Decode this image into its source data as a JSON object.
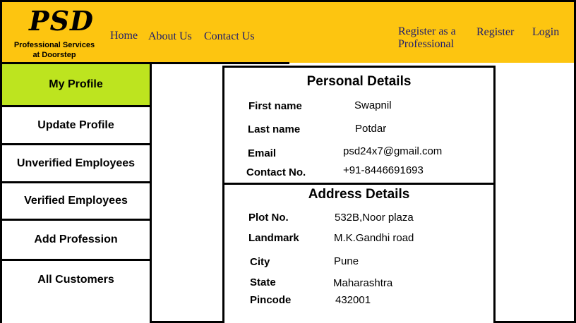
{
  "brand": {
    "logo": "PSD",
    "tagline_line1": "Professional Services",
    "tagline_line2": "at Doorstep"
  },
  "nav": {
    "home": "Home",
    "about": "About Us",
    "contact": "Contact Us",
    "register_professional_line1": "Register as a",
    "register_professional_line2": "Professional",
    "register": "Register",
    "login": "Login"
  },
  "sidebar": {
    "items": [
      {
        "label": "My Profile",
        "active": true
      },
      {
        "label": "Update Profile",
        "active": false
      },
      {
        "label": "Unverified Employees",
        "active": false
      },
      {
        "label": "Verified Employees",
        "active": false
      },
      {
        "label": "Add Profession",
        "active": false
      },
      {
        "label": "All Customers",
        "active": false
      }
    ]
  },
  "personal": {
    "title": "Personal Details",
    "first_name_label": "First name",
    "first_name": "Swapnil",
    "last_name_label": "Last name",
    "last_name": "Potdar",
    "email_label": "Email",
    "email": "psd24x7@gmail.com",
    "contact_label": "Contact No.",
    "contact": "+91-8446691693"
  },
  "address": {
    "title": "Address Details",
    "plot_label": "Plot No.",
    "plot": "532B,Noor plaza",
    "landmark_label": "Landmark",
    "landmark": "M.K.Gandhi road",
    "city_label": "City",
    "city": "Pune",
    "state_label": "State",
    "state": "Maharashtra",
    "pincode_label": "Pincode",
    "pincode": "432001"
  },
  "colors": {
    "header_bg": "#FDC510",
    "active_item_bg": "#BDE41F",
    "nav_text": "#1c1c6e"
  }
}
